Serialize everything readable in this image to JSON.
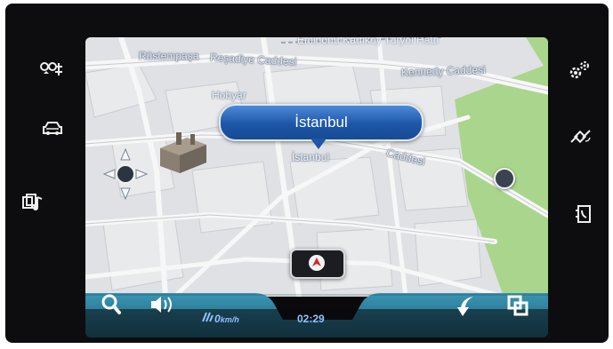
{
  "map": {
    "city_popup": "İstanbul",
    "labels": {
      "street_top_left": "Rüstempaşa",
      "street_resadiye": "Reşadiye Caddesi",
      "street_kennedy": "Kennedy Caddesi",
      "ferry_line": "Eminönü-Kadıköy Turyol Hattı",
      "poi_hobyar": "Hobyar",
      "poi_istanbul": "İstanbul",
      "street_caddesi": "Caddesi"
    }
  },
  "bottom_bar": {
    "speed_value": "0",
    "speed_unit": "km/h",
    "clock": "02:29"
  },
  "left_controls": [
    {
      "icon": "fan-settings-icon"
    },
    {
      "icon": "car-icon"
    },
    {
      "icon": "media-music-icon"
    }
  ],
  "right_controls": [
    {
      "icon": "gears-icon"
    },
    {
      "icon": "satellite-icon"
    },
    {
      "icon": "phone-book-icon"
    }
  ],
  "colors": {
    "bezel": "#0d0d0f",
    "map_background": "#e3e4e6",
    "popup_blue": "#1d56a8",
    "bar_teal": "#2a7f9c",
    "accent_text": "#8fc3ff",
    "park_green": "#a9d68c"
  }
}
